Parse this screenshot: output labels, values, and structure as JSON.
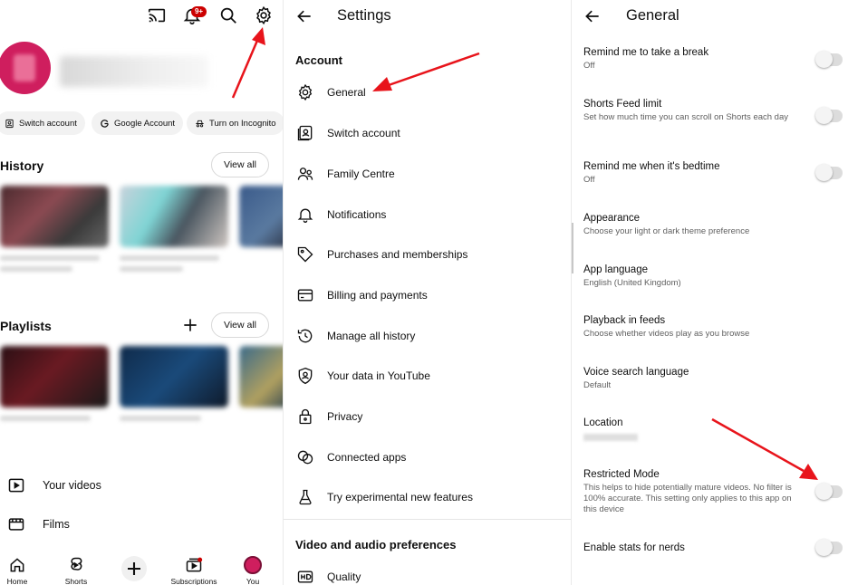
{
  "colors": {
    "accent": "#cc0000",
    "brand_avatar": "#cf1e5e",
    "arrow": "#e8141b"
  },
  "youtube_panel": {
    "top_icons": [
      "cast-icon",
      "bell-icon",
      "search-icon",
      "gear-icon"
    ],
    "notification_badge": "9+",
    "chips": [
      {
        "label": "Switch account",
        "icon": "switch-account-icon"
      },
      {
        "label": "Google Account",
        "icon": "google-icon"
      },
      {
        "label": "Turn on Incognito",
        "icon": "incognito-icon"
      }
    ],
    "history_title": "History",
    "playlists_title": "Playlists",
    "view_all": "View all",
    "nav_items": [
      {
        "label": "Your videos",
        "icon": "play-square-icon"
      },
      {
        "label": "Films",
        "icon": "film-icon"
      }
    ],
    "bottom_nav": [
      {
        "label": "Home",
        "icon": "home-icon"
      },
      {
        "label": "Shorts",
        "icon": "shorts-icon"
      },
      {
        "label": "Subscriptions",
        "icon": "subscriptions-icon"
      },
      {
        "label": "You",
        "icon": "avatar"
      }
    ]
  },
  "settings_panel": {
    "title": "Settings",
    "account_header": "Account",
    "items": [
      {
        "label": "General",
        "icon": "gear-icon"
      },
      {
        "label": "Switch account",
        "icon": "switch-account-icon"
      },
      {
        "label": "Family Centre",
        "icon": "family-icon"
      },
      {
        "label": "Notifications",
        "icon": "bell-icon"
      },
      {
        "label": "Purchases and memberships",
        "icon": "tag-icon"
      },
      {
        "label": "Billing and payments",
        "icon": "card-icon"
      },
      {
        "label": "Manage all history",
        "icon": "history-icon"
      },
      {
        "label": "Your data in YouTube",
        "icon": "shield-person-icon"
      },
      {
        "label": "Privacy",
        "icon": "lock-icon"
      },
      {
        "label": "Connected apps",
        "icon": "link-circles-icon"
      },
      {
        "label": "Try experimental new features",
        "icon": "flask-icon"
      }
    ],
    "video_header": "Video and audio preferences",
    "quality_label": "Quality"
  },
  "general_panel": {
    "title": "General",
    "items": [
      {
        "title": "Remind me to take a break",
        "subtitle": "Off",
        "toggle": true
      },
      {
        "title": "Shorts Feed limit",
        "subtitle": "Set how much time you can scroll on Shorts each day",
        "toggle": true
      },
      {
        "title": "Remind me when it's bedtime",
        "subtitle": "Off",
        "toggle": true
      },
      {
        "title": "Appearance",
        "subtitle": "Choose your light or dark theme preference",
        "toggle": false
      },
      {
        "title": "App language",
        "subtitle": "English (United Kingdom)",
        "toggle": false
      },
      {
        "title": "Playback in feeds",
        "subtitle": "Choose whether videos play as you browse",
        "toggle": false
      },
      {
        "title": "Voice search language",
        "subtitle": "Default",
        "toggle": false
      },
      {
        "title": "Location",
        "subtitle": "",
        "toggle": false
      },
      {
        "title": "Restricted Mode",
        "subtitle": "This helps to hide potentially mature videos. No filter is 100% accurate. This setting only applies to this app on this device",
        "toggle": true
      },
      {
        "title": "Enable stats for nerds",
        "subtitle": "",
        "toggle": true
      }
    ]
  }
}
